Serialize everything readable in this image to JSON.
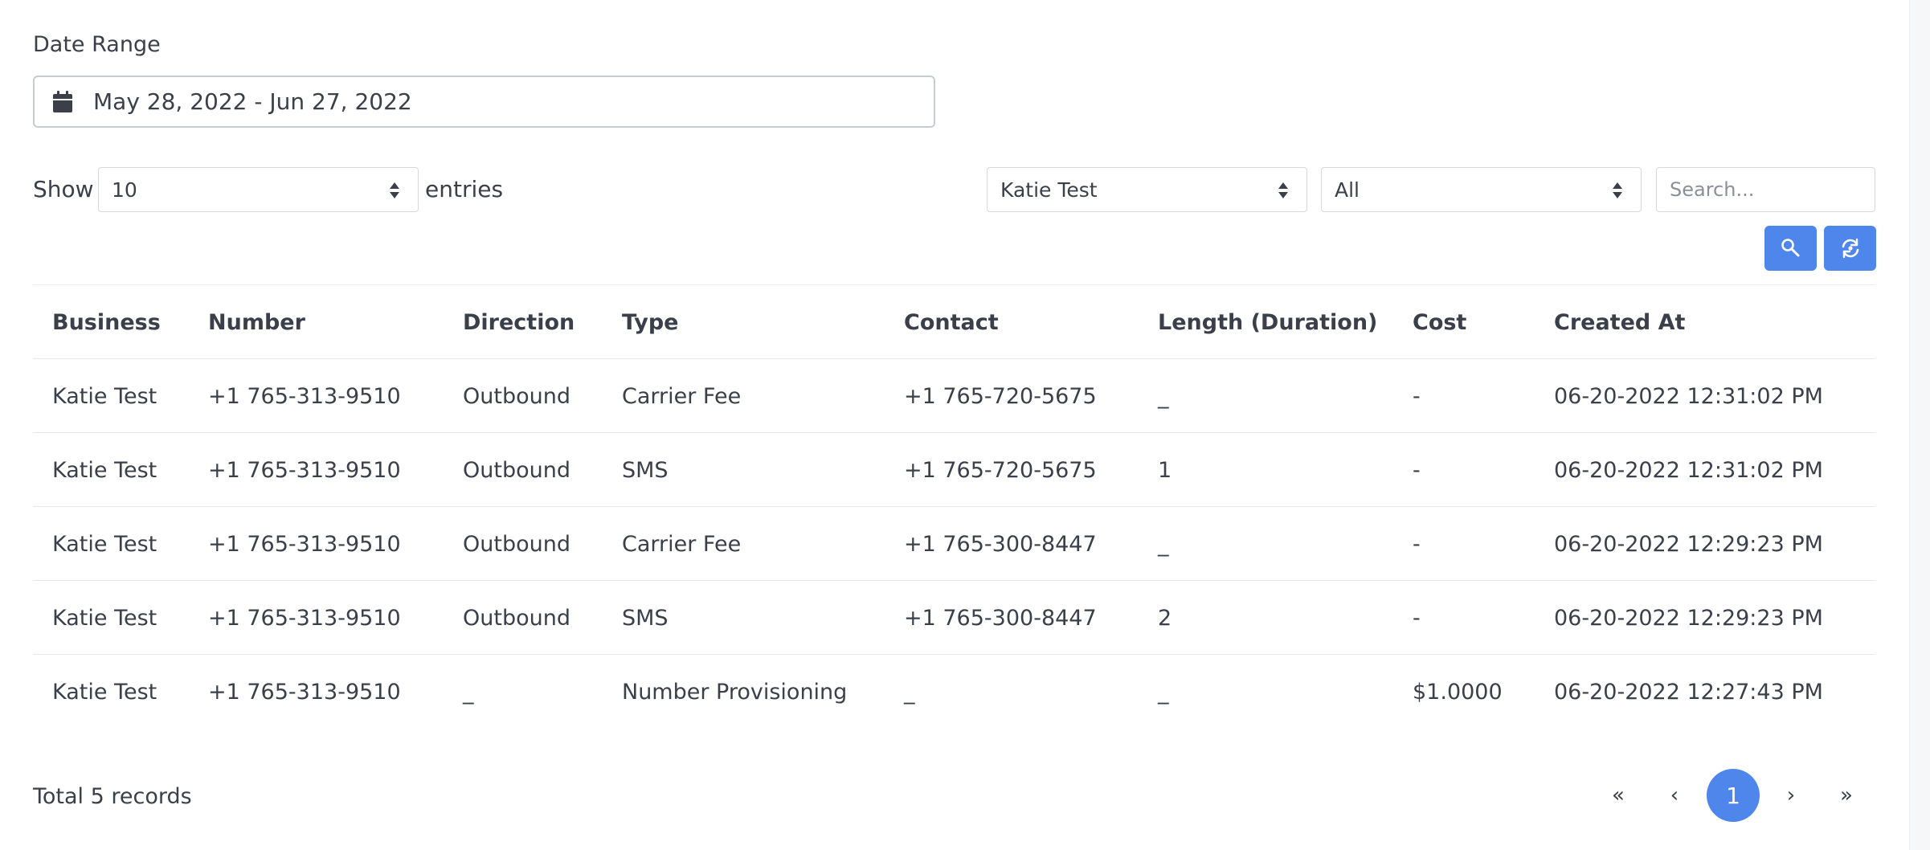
{
  "filters": {
    "date_label": "Date Range",
    "date_value": "May 28, 2022 - Jun 27, 2022",
    "show_label": "Show",
    "entries_value": "10",
    "entries_label": "entries",
    "business_value": "Katie Test",
    "type_value": "All",
    "search_placeholder": "Search..."
  },
  "table": {
    "headers": [
      "Business",
      "Number",
      "Direction",
      "Type",
      "Contact",
      "Length (Duration)",
      "Cost",
      "Created At"
    ],
    "rows": [
      [
        "Katie Test",
        "+1 765-313-9510",
        "Outbound",
        "Carrier Fee",
        "+1 765-720-5675",
        "_",
        "-",
        "06-20-2022 12:31:02 PM"
      ],
      [
        "Katie Test",
        "+1 765-313-9510",
        "Outbound",
        "SMS",
        "+1 765-720-5675",
        "1",
        "-",
        "06-20-2022 12:31:02 PM"
      ],
      [
        "Katie Test",
        "+1 765-313-9510",
        "Outbound",
        "Carrier Fee",
        "+1 765-300-8447",
        "_",
        "-",
        "06-20-2022 12:29:23 PM"
      ],
      [
        "Katie Test",
        "+1 765-313-9510",
        "Outbound",
        "SMS",
        "+1 765-300-8447",
        "2",
        "-",
        "06-20-2022 12:29:23 PM"
      ],
      [
        "Katie Test",
        "+1 765-313-9510",
        "_",
        "Number Provisioning",
        "_",
        "_",
        "$1.0000",
        "06-20-2022 12:27:43 PM"
      ]
    ]
  },
  "footer": {
    "total": "Total 5 records",
    "pager_first": "«",
    "pager_prev": "‹",
    "pager_current": "1",
    "pager_next": "›",
    "pager_last": "»"
  },
  "colors": {
    "accent": "#4f86ec",
    "text": "#3b3f4a",
    "border": "#d5d8de"
  },
  "icons": {
    "date": "calendar-icon",
    "select": "sort-icon",
    "search_button": "search-icon",
    "reset_button": "reset-icon"
  }
}
